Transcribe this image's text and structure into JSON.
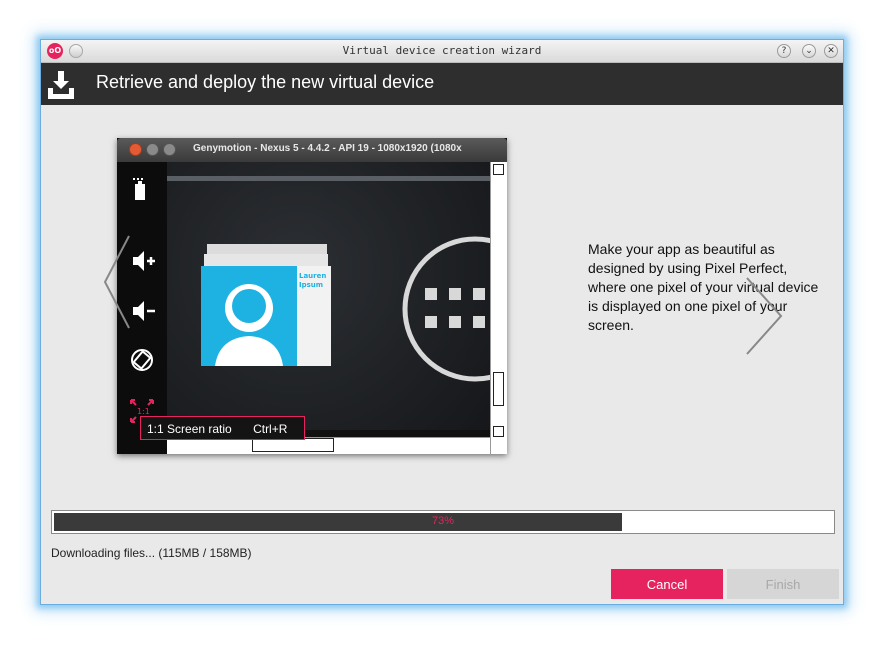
{
  "window": {
    "title": "Virtual device creation wizard",
    "logo_text": "oO",
    "controls": {
      "help": "?",
      "minimize": "⌄",
      "close": "✕"
    }
  },
  "header": {
    "title": "Retrieve and deploy the new virtual device",
    "icon": "download-deploy-icon"
  },
  "preview": {
    "window_title": "Genymotion - Nexus 5 - 4.4.2 - API 19 - 1080x1920 (1080x",
    "tooltip_label": "1:1 Screen ratio",
    "tooltip_shortcut": "Ctrl+R",
    "side_icons": [
      "battery-icon",
      "volume-up-icon",
      "volume-down-icon",
      "rotate-icon",
      "pixel-perfect-icon"
    ],
    "card_name": "Lauren Ipsum",
    "ratio_label": "1:1"
  },
  "description": "Make your app as beautiful as designed by using Pixel Perfect, where one pixel of your virtual device is displayed on one pixel of your screen.",
  "progress": {
    "value": 0.73,
    "label": "73%"
  },
  "status": "Downloading files... (115MB / 158MB)",
  "buttons": {
    "cancel": "Cancel",
    "finish": "Finish"
  },
  "colors": {
    "accent": "#e7235f",
    "header_bg": "#2e2e2e",
    "window_bg": "#e9e9e9"
  }
}
